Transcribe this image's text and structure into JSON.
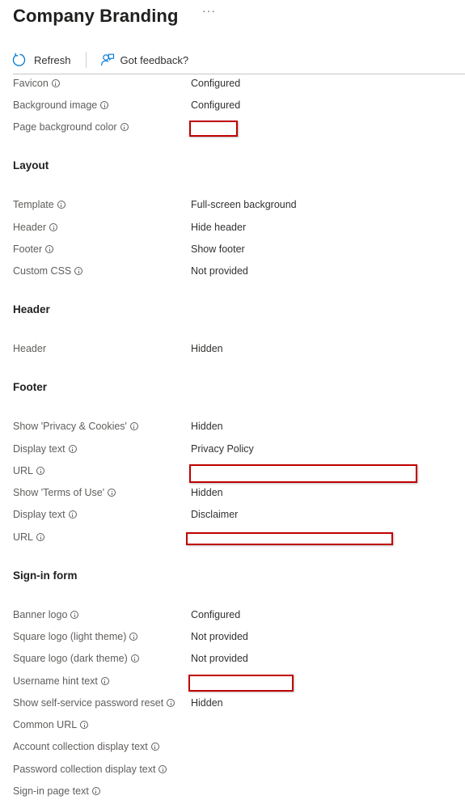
{
  "page": {
    "title": "Company Branding",
    "more_glyph": "···"
  },
  "toolbar": {
    "refresh_label": "Refresh",
    "feedback_label": "Got feedback?"
  },
  "icons": {
    "refresh": "refresh-icon",
    "feedback": "feedback-icon",
    "info": "info-icon"
  },
  "colors": {
    "redaction_border": "#c00000",
    "divider": "#c8c6c4"
  },
  "sections": {
    "layout": "Layout",
    "header": "Header",
    "footer": "Footer",
    "signin": "Sign-in form"
  },
  "rows": {
    "favicon": {
      "label": "Favicon",
      "value": "Configured"
    },
    "background_image": {
      "label": "Background image",
      "value": "Configured"
    },
    "page_bg_color": {
      "label": "Page background color",
      "value": ""
    },
    "template": {
      "label": "Template",
      "value": "Full-screen background"
    },
    "header": {
      "label": "Header",
      "value": "Hide header"
    },
    "footer": {
      "label": "Footer",
      "value": "Show footer"
    },
    "custom_css": {
      "label": "Custom CSS",
      "value": "Not provided"
    },
    "header_visibility": {
      "label": "Header",
      "value": "Hidden"
    },
    "privacy": {
      "label": "Show 'Privacy & Cookies'",
      "value": "Hidden"
    },
    "privacy_display": {
      "label": "Display text",
      "value": "Privacy Policy"
    },
    "privacy_url": {
      "label": "URL",
      "value": ""
    },
    "terms": {
      "label": "Show 'Terms of Use'",
      "value": "Hidden"
    },
    "terms_display": {
      "label": "Display text",
      "value": "Disclaimer"
    },
    "terms_url": {
      "label": "URL",
      "value": ""
    },
    "banner_logo": {
      "label": "Banner logo",
      "value": "Configured"
    },
    "square_logo_light": {
      "label": "Square logo (light theme)",
      "value": "Not provided"
    },
    "square_logo_dark": {
      "label": "Square logo (dark theme)",
      "value": "Not provided"
    },
    "username_hint": {
      "label": "Username hint text",
      "value": ""
    },
    "sspr": {
      "label": "Show self-service password reset",
      "value": "Hidden"
    },
    "common_url": {
      "label": "Common URL",
      "value": ""
    },
    "account_collection": {
      "label": "Account collection display text",
      "value": ""
    },
    "password_collection": {
      "label": "Password collection display text",
      "value": ""
    },
    "signin_page_text": {
      "label": "Sign-in page text",
      "value": ""
    }
  }
}
